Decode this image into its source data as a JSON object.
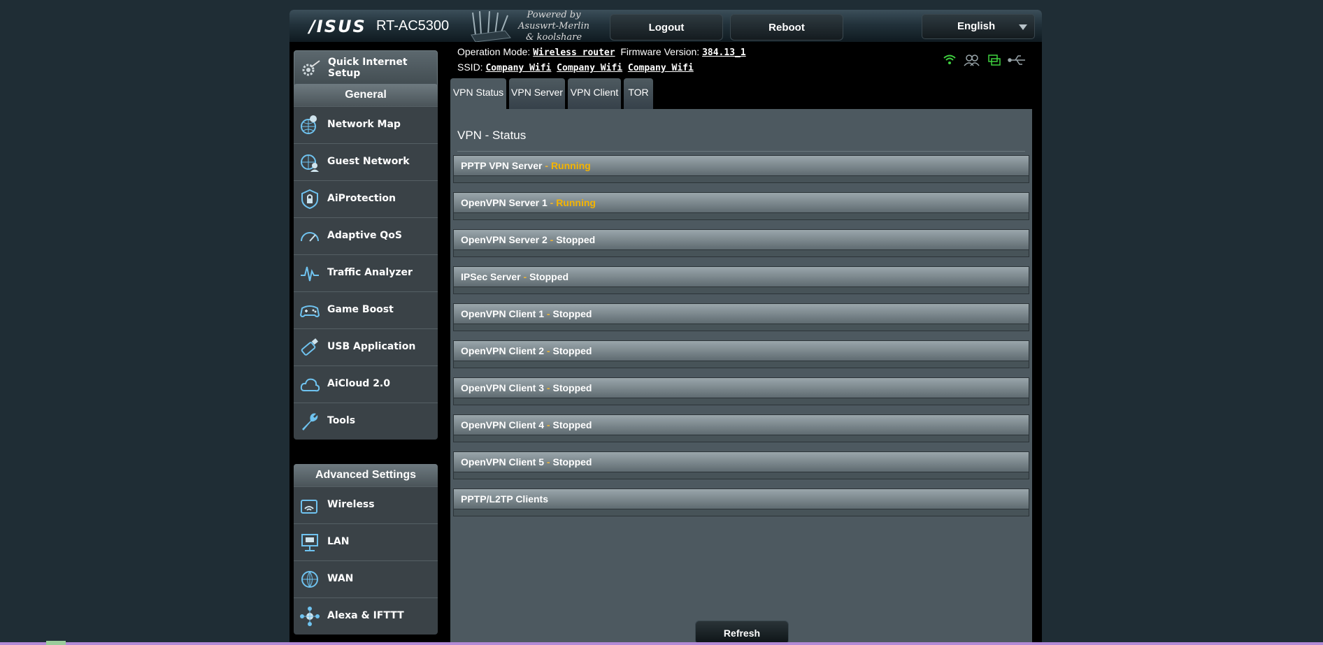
{
  "header": {
    "brand": "/ISUS",
    "model": "RT-AC5300",
    "powered_by": [
      "Powered by",
      "Asuswrt-Merlin",
      "& koolshare"
    ],
    "logout_label": "Logout",
    "reboot_label": "Reboot",
    "language": "English"
  },
  "info": {
    "operation_mode_label": "Operation Mode:",
    "operation_mode_value": "Wireless router",
    "firmware_label": "Firmware Version:",
    "firmware_value": "384.13_1",
    "ssid_label": "SSID:",
    "ssids": [
      "Company Wifi",
      "Company Wifi",
      "Company Wifi"
    ]
  },
  "status_icons": [
    "wifi-icon",
    "clients-icon",
    "network-icon",
    "usb-icon"
  ],
  "sidebar": {
    "quick_setup": "Quick Internet Setup",
    "general_header": "General",
    "general_items": [
      {
        "label": "Network Map",
        "icon": "globe-pin-icon"
      },
      {
        "label": "Guest Network",
        "icon": "guest-globe-icon"
      },
      {
        "label": "AiProtection",
        "icon": "shield-lock-icon"
      },
      {
        "label": "Adaptive QoS",
        "icon": "speedometer-icon"
      },
      {
        "label": "Traffic Analyzer",
        "icon": "waveform-icon"
      },
      {
        "label": "Game Boost",
        "icon": "gamepad-icon"
      },
      {
        "label": "USB Application",
        "icon": "usb-stick-icon"
      },
      {
        "label": "AiCloud 2.0",
        "icon": "cloud-icon"
      },
      {
        "label": "Tools",
        "icon": "wrench-icon"
      }
    ],
    "advanced_header": "Advanced Settings",
    "advanced_items": [
      {
        "label": "Wireless",
        "icon": "wireless-icon"
      },
      {
        "label": "LAN",
        "icon": "lan-icon"
      },
      {
        "label": "WAN",
        "icon": "wan-globe-icon"
      },
      {
        "label": "Alexa & IFTTT",
        "icon": "alexa-icon"
      }
    ]
  },
  "tabs": [
    "VPN Status",
    "VPN Server",
    "VPN Client",
    "TOR"
  ],
  "active_tab": "VPN Status",
  "panel": {
    "title": "VPN - Status",
    "sections": [
      {
        "name": "PPTP VPN Server",
        "status": "Running"
      },
      {
        "name": "OpenVPN Server 1",
        "status": "Running"
      },
      {
        "name": "OpenVPN Server 2",
        "status": "Stopped"
      },
      {
        "name": "IPSec Server",
        "status": "Stopped"
      },
      {
        "name": "OpenVPN Client 1",
        "status": "Stopped"
      },
      {
        "name": "OpenVPN Client 2",
        "status": "Stopped"
      },
      {
        "name": "OpenVPN Client 3",
        "status": "Stopped"
      },
      {
        "name": "OpenVPN Client 4",
        "status": "Stopped"
      },
      {
        "name": "OpenVPN Client 5",
        "status": "Stopped"
      },
      {
        "name": "PPTP/L2TP Clients",
        "status": ""
      }
    ],
    "refresh_label": "Refresh"
  },
  "colors": {
    "background": "#1f2d35",
    "running": "#f5b400",
    "icon_blue": "#6fc3f0",
    "status_green": "#3fd13f"
  }
}
